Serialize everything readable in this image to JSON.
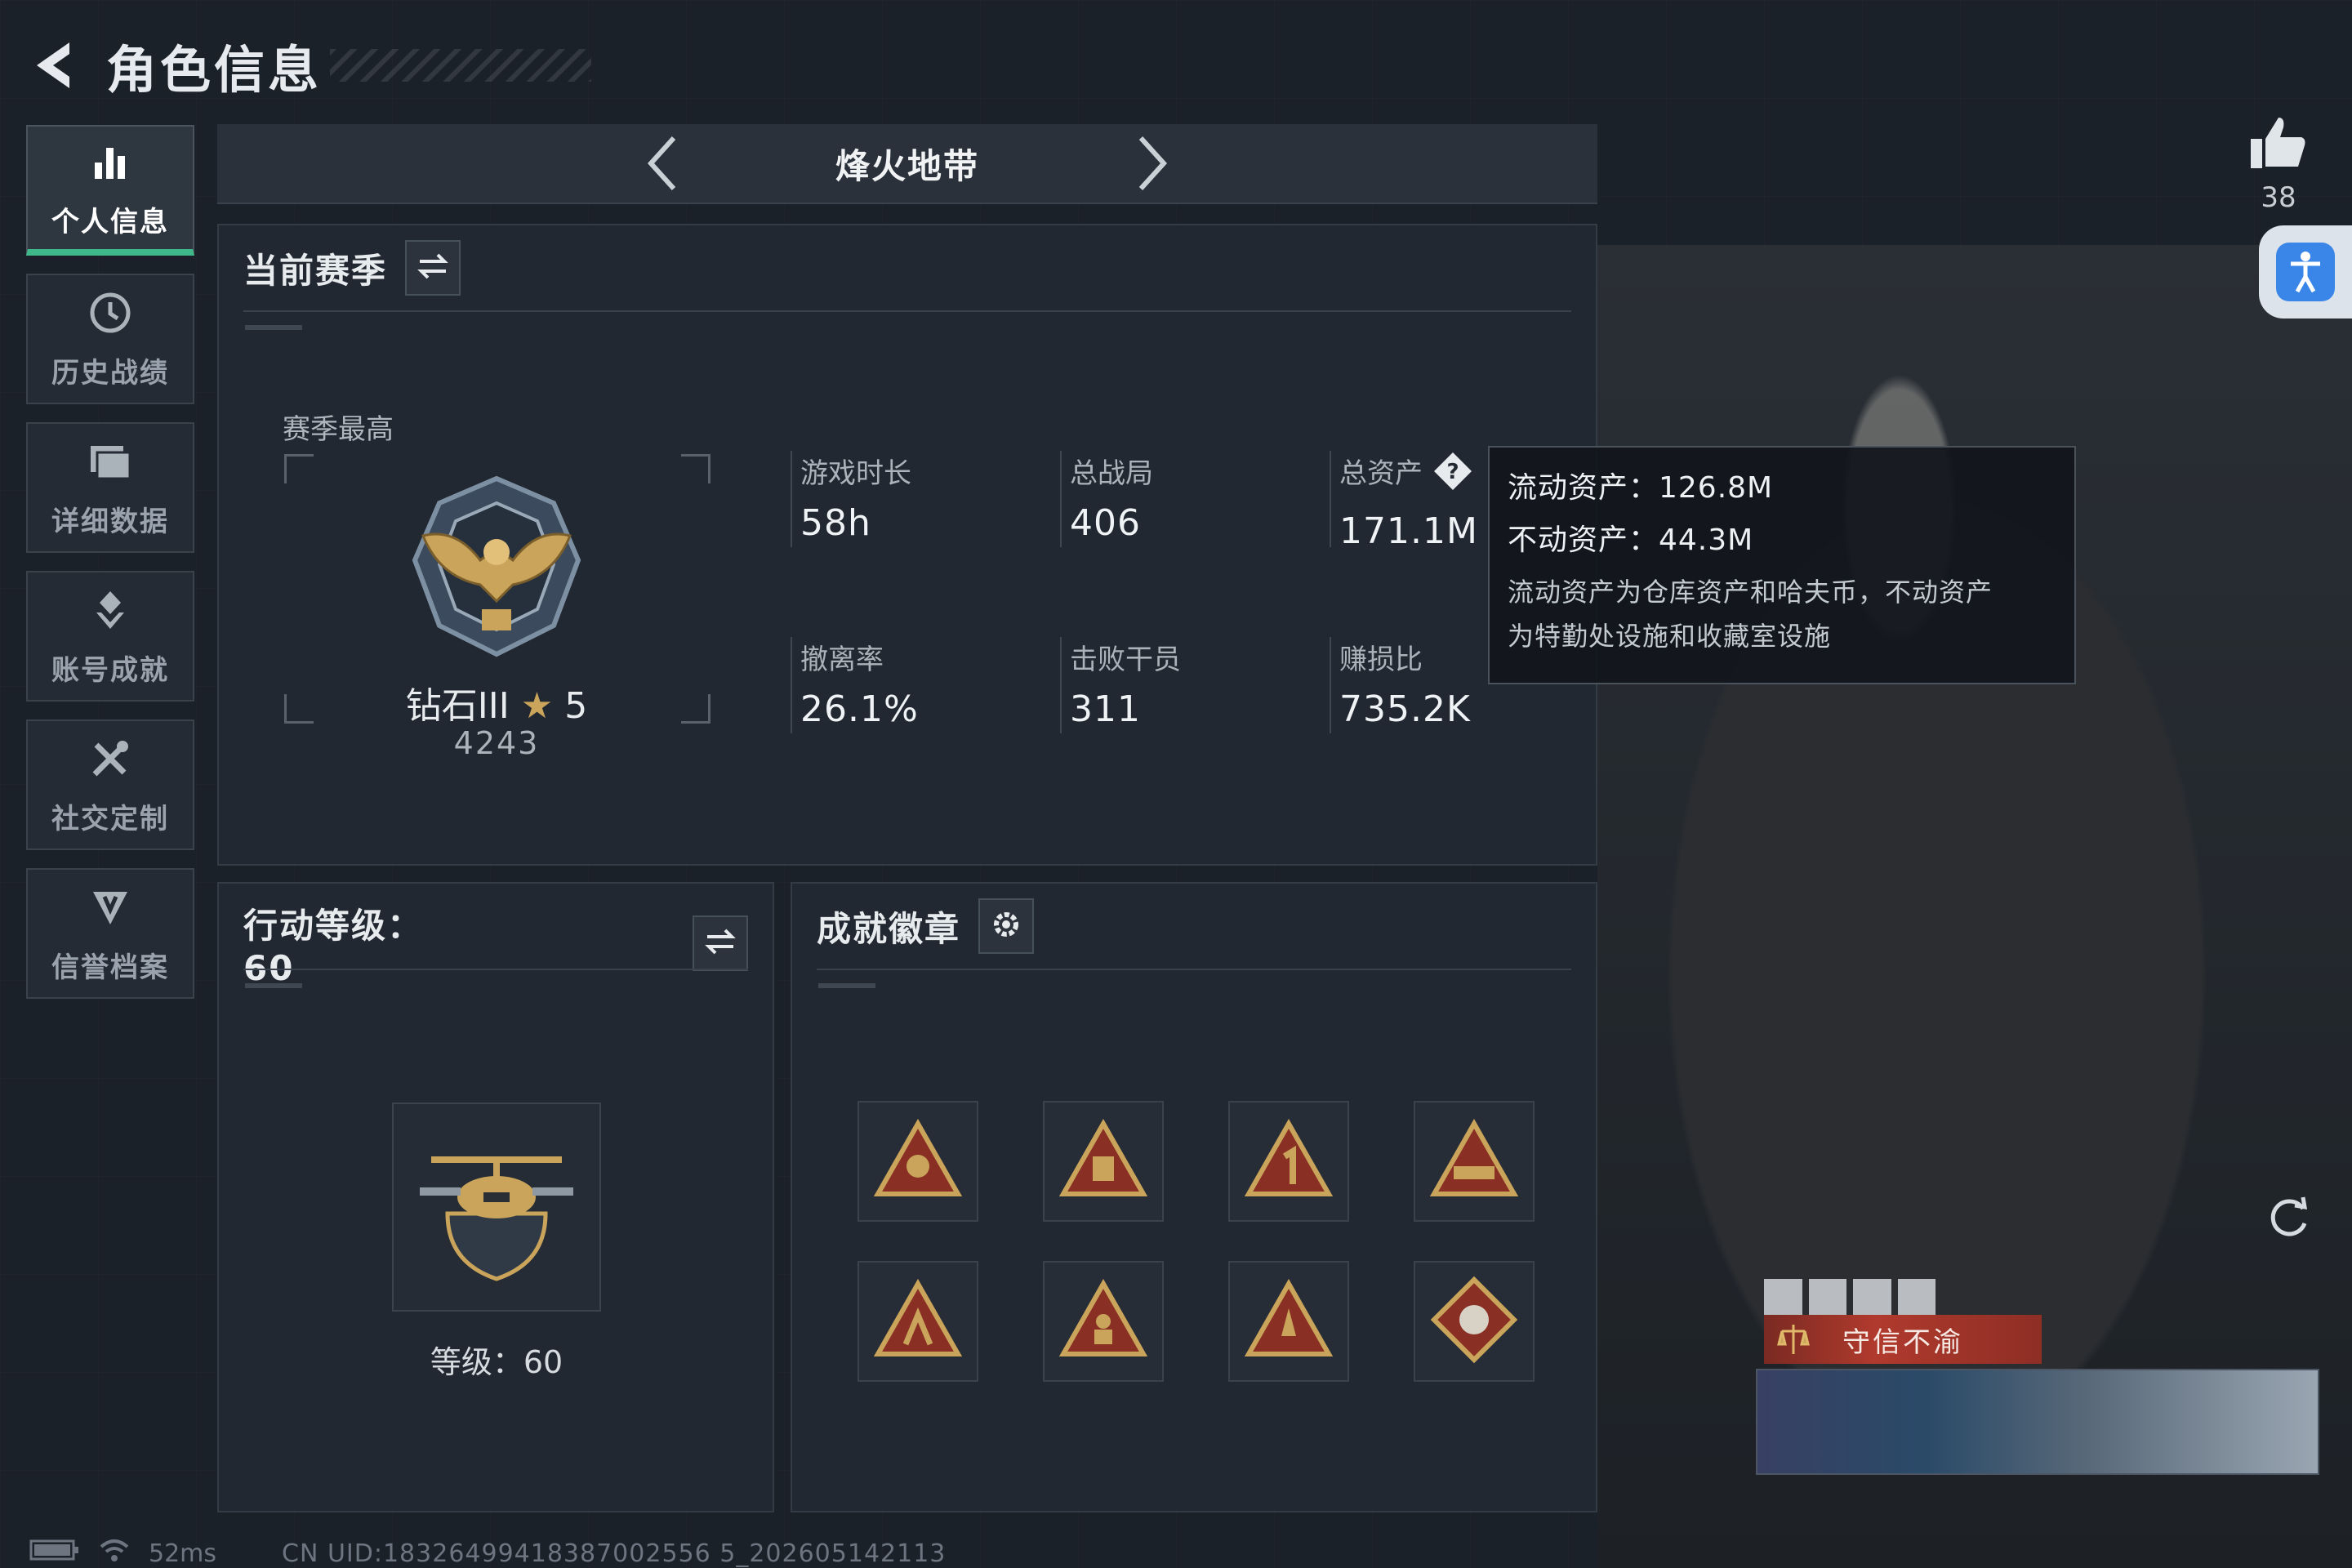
{
  "header": {
    "title": "角色信息"
  },
  "sidebar": {
    "items": [
      {
        "label": "个人信息",
        "icon": "bar-chart-icon",
        "active": true
      },
      {
        "label": "历史战绩",
        "icon": "history-clock-icon",
        "active": false
      },
      {
        "label": "详细数据",
        "icon": "folder-icon",
        "active": false
      },
      {
        "label": "账号成就",
        "icon": "achievement-icon",
        "active": false
      },
      {
        "label": "社交定制",
        "icon": "tools-icon",
        "active": false
      },
      {
        "label": "信誉档案",
        "icon": "shield-icon",
        "active": false
      }
    ]
  },
  "mode": {
    "name": "烽火地带"
  },
  "season": {
    "title": "当前赛季",
    "best_label": "赛季最高",
    "rank_name": "钻石III",
    "rank_stars": "5",
    "rank_score": "4243",
    "stats": [
      {
        "key": "游戏时长",
        "value": "58h"
      },
      {
        "key": "总战局",
        "value": "406"
      },
      {
        "key": "总资产",
        "value": "171.1M"
      },
      {
        "key": "撤离率",
        "value": "26.1%"
      },
      {
        "key": "击败干员",
        "value": "311"
      },
      {
        "key": "赚损比",
        "value": "735.2K"
      }
    ]
  },
  "tooltip": {
    "liquid": "流动资产：126.8M",
    "fixed": "不动资产：44.3M",
    "desc_line1": "流动资产为仓库资产和哈夫币，不动资产",
    "desc_line2": "为特勤处设施和收藏室设施"
  },
  "level": {
    "title": "行动等级：60",
    "label": "等级：60"
  },
  "badges": {
    "title": "成就徽章",
    "items": [
      "badge-1",
      "badge-2",
      "badge-3",
      "badge-4",
      "badge-5",
      "badge-6",
      "badge-7",
      "badge-8"
    ]
  },
  "character": {
    "likes": "38",
    "title_tag": "守信不渝"
  },
  "status": {
    "ping": "52ms",
    "uid": "CN UID:18326499418387002556 5_202605142113"
  },
  "colors": {
    "accent": "#3fb98a",
    "gold": "#c9a45a",
    "panel": "#222932"
  }
}
